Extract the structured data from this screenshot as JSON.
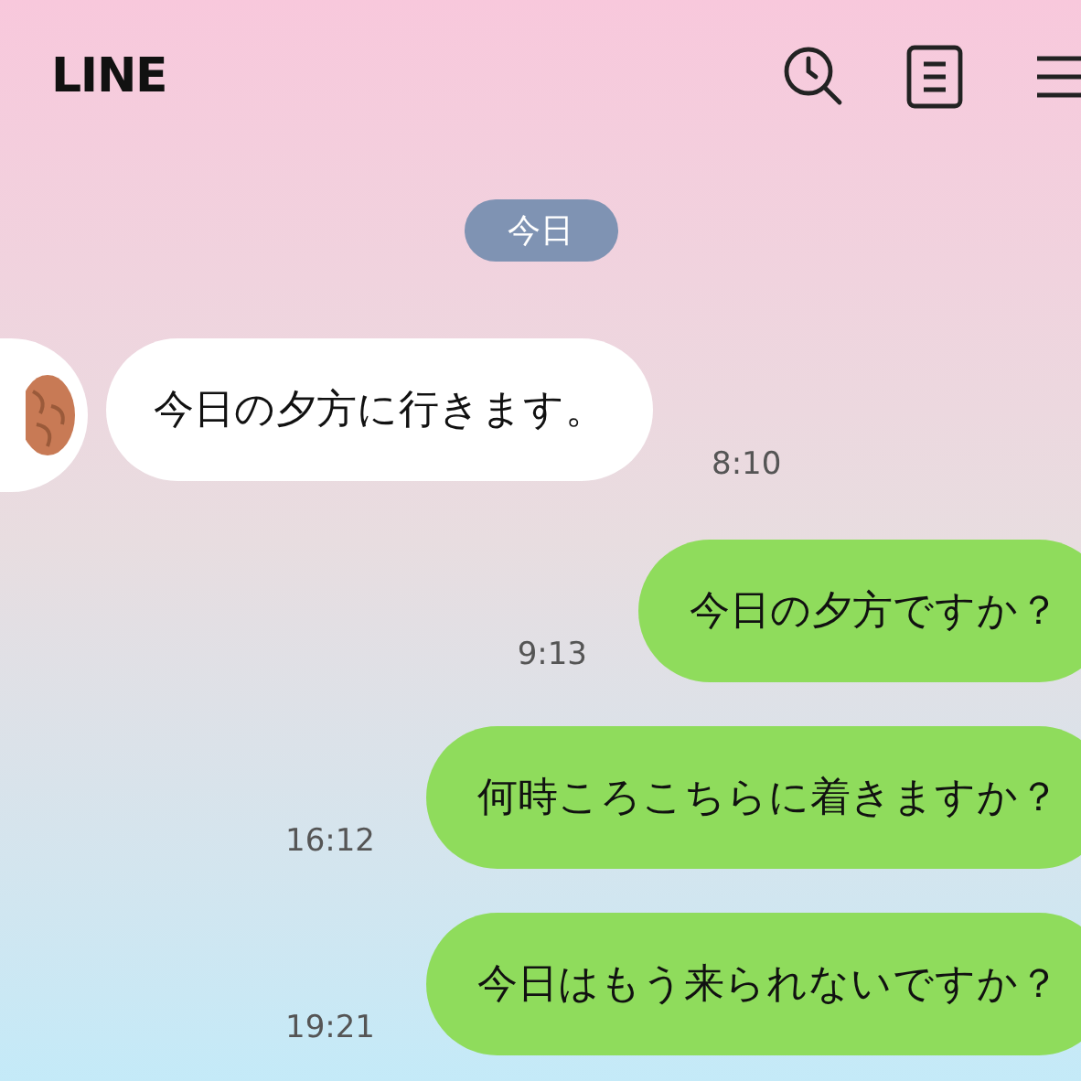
{
  "header": {
    "title": "LINE"
  },
  "date_chip": "今日",
  "messages": [
    {
      "kind": "incoming",
      "text": "今日の夕方に行きます。",
      "time": "8:10"
    },
    {
      "kind": "outgoing",
      "text": "今日の夕方ですか？",
      "time": "9:13"
    },
    {
      "kind": "outgoing",
      "text": "何時ころこちらに着きますか？",
      "time": "16:12"
    },
    {
      "kind": "outgoing",
      "text": "今日はもう来られないですか？",
      "time": "19:21"
    }
  ]
}
